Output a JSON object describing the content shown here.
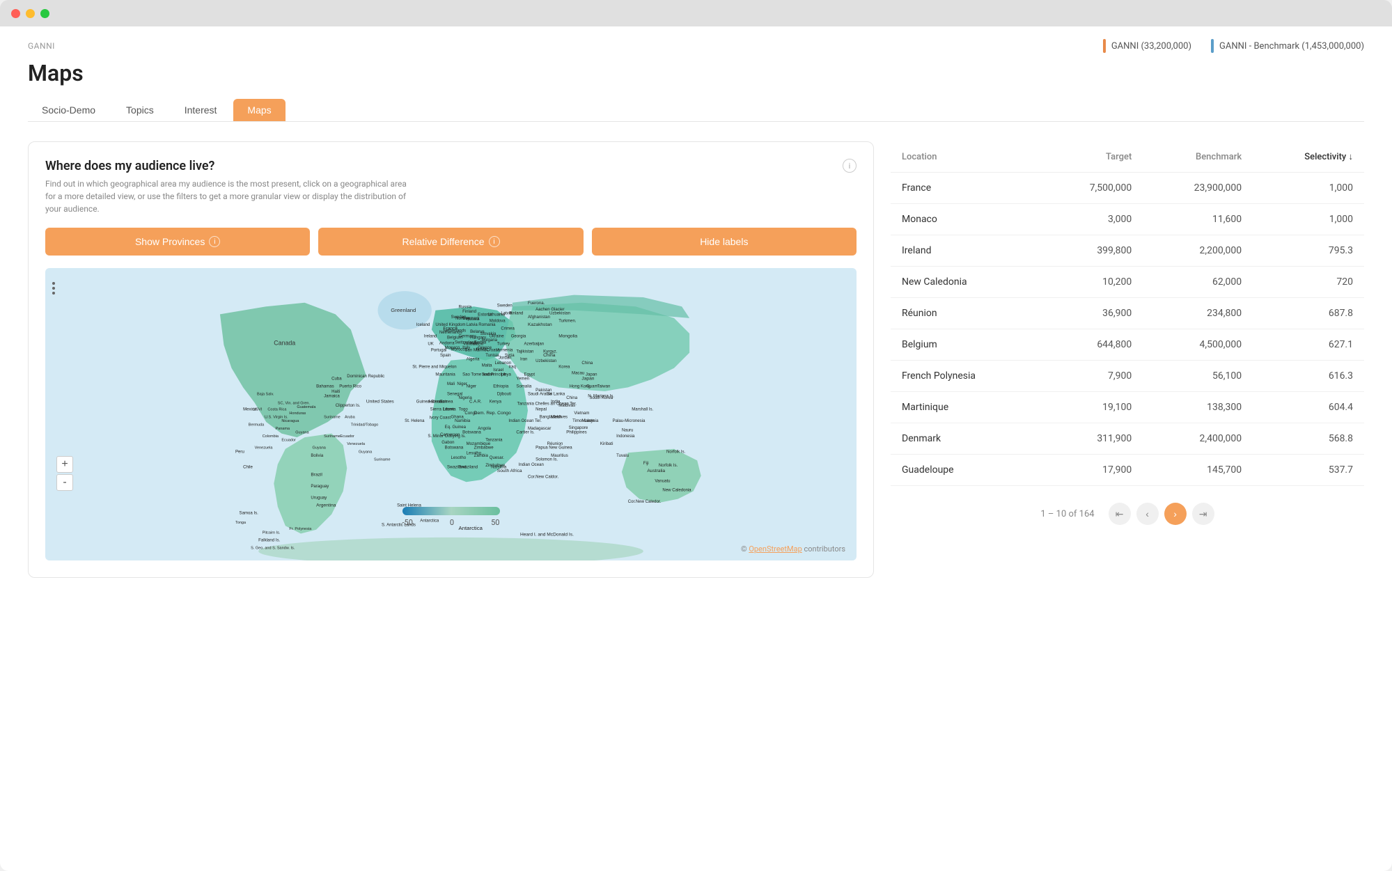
{
  "app": {
    "brand": "GANNI",
    "title": "Maps",
    "window_controls": [
      "close",
      "minimize",
      "maximize"
    ]
  },
  "header": {
    "legend": [
      {
        "id": "ganni",
        "label": "GANNI  (33,200,000)",
        "color": "#e88a4a"
      },
      {
        "id": "benchmark",
        "label": "GANNI - Benchmark  (1,453,000,000)",
        "color": "#5b9ec9"
      }
    ]
  },
  "tabs": [
    {
      "id": "socio-demo",
      "label": "Socio-Demo",
      "active": false
    },
    {
      "id": "topics",
      "label": "Topics",
      "active": false
    },
    {
      "id": "interest",
      "label": "Interest",
      "active": false
    },
    {
      "id": "maps",
      "label": "Maps",
      "active": true
    }
  ],
  "map_panel": {
    "title": "Where does my audience live?",
    "description": "Find out in which geographical area my audience is the most present, click on a geographical area for a more detailed view, or use the filters to get a more granular view or display the distribution of your audience.",
    "buttons": [
      {
        "id": "show-provinces",
        "label": "Show Provinces",
        "has_info": true
      },
      {
        "id": "relative-difference",
        "label": "Relative Difference",
        "has_info": true
      },
      {
        "id": "hide-labels",
        "label": "Hide labels",
        "has_info": false
      }
    ],
    "zoom_plus": "+",
    "zoom_minus": "-",
    "legend": {
      "min": "-50",
      "mid": "0",
      "max": "50"
    },
    "credit_text": "© ",
    "credit_link": "OpenStreetMap",
    "credit_suffix": " contributors"
  },
  "table": {
    "columns": [
      {
        "id": "location",
        "label": "Location"
      },
      {
        "id": "target",
        "label": "Target"
      },
      {
        "id": "benchmark",
        "label": "Benchmark"
      },
      {
        "id": "selectivity",
        "label": "Selectivity ↓"
      }
    ],
    "rows": [
      {
        "location": "France",
        "target": "7,500,000",
        "benchmark": "23,900,000",
        "selectivity": "1,000"
      },
      {
        "location": "Monaco",
        "target": "3,000",
        "benchmark": "11,600",
        "selectivity": "1,000"
      },
      {
        "location": "Ireland",
        "target": "399,800",
        "benchmark": "2,200,000",
        "selectivity": "795.3"
      },
      {
        "location": "New Caledonia",
        "target": "10,200",
        "benchmark": "62,000",
        "selectivity": "720"
      },
      {
        "location": "Réunion",
        "target": "36,900",
        "benchmark": "234,800",
        "selectivity": "687.8"
      },
      {
        "location": "Belgium",
        "target": "644,800",
        "benchmark": "4,500,000",
        "selectivity": "627.1"
      },
      {
        "location": "French Polynesia",
        "target": "7,900",
        "benchmark": "56,100",
        "selectivity": "616.3"
      },
      {
        "location": "Martinique",
        "target": "19,100",
        "benchmark": "138,300",
        "selectivity": "604.4"
      },
      {
        "location": "Denmark",
        "target": "311,900",
        "benchmark": "2,400,000",
        "selectivity": "568.8"
      },
      {
        "location": "Guadeloupe",
        "target": "17,900",
        "benchmark": "145,700",
        "selectivity": "537.7"
      }
    ],
    "pagination": {
      "info": "1 – 10 of 164",
      "buttons": [
        "first",
        "prev",
        "next",
        "last"
      ]
    }
  }
}
